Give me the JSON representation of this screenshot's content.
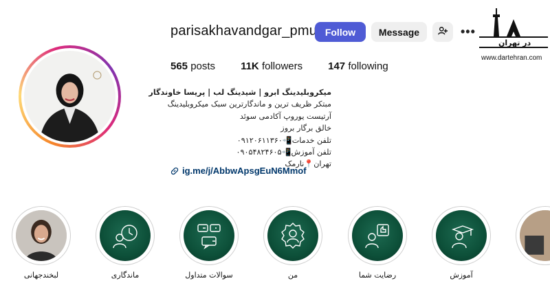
{
  "profile": {
    "username": "parisakhavandgar_pmu",
    "follow_label": "Follow",
    "message_label": "Message",
    "more_label": "•••"
  },
  "stats": {
    "posts_count": "565",
    "posts_label": "posts",
    "followers_count": "11K",
    "followers_label": "followers",
    "following_count": "147",
    "following_label": "following"
  },
  "bio": {
    "name": "میکروبلیدینگ ابرو | شیدینگ لب | پریسا خاوندگار",
    "lines": [
      "مبتکر ظریف ترین و ماندگارترین سبک میکروبلیدینگ",
      "آرتیست یوروپ آکادمی سوئد",
      "خالق برگار بروز",
      "تلفن خدمات📲۰۹۱۲۰۶۱۱۳۶۰",
      "تلفن آموزش📲۰۹۰۵۴۸۲۴۶۰۵",
      "تهران📍نارمک"
    ],
    "link": "ig.me/j/AbbwApsgEuN6Mmof"
  },
  "highlights": [
    {
      "label": "لبخندجهانی",
      "icon": "portrait-photo"
    },
    {
      "label": "ماندگاری",
      "icon": "woman-clock-icon"
    },
    {
      "label": "سوالات متداول",
      "icon": "faq-chat-icon"
    },
    {
      "label": "من",
      "icon": "woman-badge-icon"
    },
    {
      "label": "رضایت شما",
      "icon": "woman-thumbs-up-icon"
    },
    {
      "label": "آموزش",
      "icon": "graduate-icon"
    }
  ],
  "watermark": {
    "title": "در تهران",
    "url": "www.dartehran.com"
  },
  "colors": {
    "follow_button": "#4f5bd5",
    "highlight_green": "#0d5039",
    "link": "#00376b"
  }
}
